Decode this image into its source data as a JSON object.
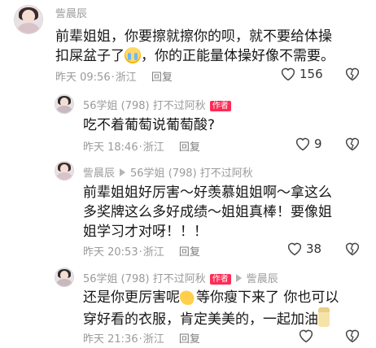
{
  "comments": [
    {
      "author": "訾晨辰",
      "text_line1": "前辈姐姐，你要擦就擦你的呗，就不要给体操",
      "text_line2a": "扣屎盆子了",
      "text_line2b": "，你的正能量体操好像不需要。",
      "emoji": "sob-emoji",
      "time": "昨天 09:56",
      "location": "浙江",
      "reply_label": "回复",
      "likes": "156"
    },
    {
      "author": "56学姐 (798) 打不过阿秋",
      "badge": "作者",
      "text_line1": "吃不着葡萄说葡萄酸?",
      "time": "昨天 18:46",
      "location": "浙江",
      "reply_label": "回复",
      "likes": "9"
    },
    {
      "author": "訾晨辰",
      "reply_to": "56学姐 (798) 打不过阿秋",
      "text_line1": "前辈姐姐好厉害～好羡慕姐姐啊～拿这么",
      "text_line2": "多奖牌这么多好成绩～姐姐真棒！要像姐",
      "text_line3": "姐学习才对呀！！！",
      "time": "昨天 20:53",
      "location": "浙江",
      "reply_label": "回复",
      "likes": "38"
    },
    {
      "author": "56学姐 (798) 打不过阿秋",
      "badge": "作者",
      "reply_to": "訾晨辰",
      "text_line1a": "还是你更厉害呢",
      "text_line1b": "等你瘦下来了 你也可以",
      "text_line2a": "穿好看的衣服，肯定美美的，一起加油",
      "emoji1": "flexed-arm-emoji",
      "emoji2": "bottle-emoji",
      "time": "昨天 21:36",
      "location": "浙江",
      "reply_label": "回复",
      "likes": ""
    }
  ],
  "location_dot": "·",
  "colors": {
    "badge": "#fe2c55",
    "meta": "#9a9a9a"
  }
}
